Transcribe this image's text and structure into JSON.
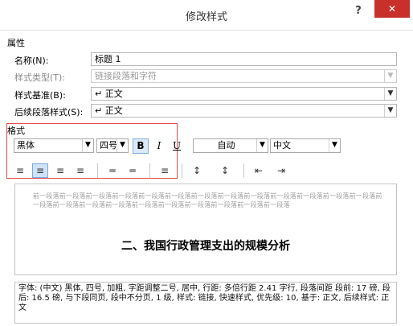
{
  "dialog": {
    "title": "修改样式",
    "help_label": "?",
    "close_label": "✕"
  },
  "properties": {
    "section_label": "属性",
    "name_label": "名称(N):",
    "name_value": "标题 1",
    "type_label": "样式类型(T):",
    "type_value": "链接段落和字符",
    "based_on_label": "样式基准(B):",
    "based_on_value": "↵ 正文",
    "following_label": "后续段落样式(S):",
    "following_value": "↵ 正文"
  },
  "format": {
    "section_label": "格式",
    "font": "黑体",
    "size": "四号",
    "bold": "B",
    "italic": "I",
    "underline": "U",
    "color": "自动",
    "language": "中文"
  },
  "preview": {
    "prev_paragraph": "前一段落前一段落前一段落前一段落前一段落前一段落前一段落前一段落前一段落前一段落前一段落前一段落前一段落前一段落前一段落前一段落前一段落前一段落前一段落前一段落前一段落前一段落前一段落",
    "heading": "二、我国行政管理支出的规模分析"
  },
  "description": "字体: (中文) 黑体, 四号, 加粗, 字距调整二号, 居中, 行距: 多倍行距 2.41 字行, 段落间距 段前: 17 磅, 段后: 16.5 磅, 与下段同页, 段中不分页, 1 级, 样式: 链接, 快速样式, 优先级: 10, 基于: 正文, 后续样式: 正文",
  "icons": {
    "dropdown": "▼",
    "align_left": "≡",
    "align_center": "≡",
    "align_right": "≡",
    "justify": "≡",
    "distribute1": "═",
    "distribute2": "═",
    "distribute3": "≡",
    "line_spacing1": "↕",
    "line_spacing2": "↕",
    "indent_decrease": "⇤",
    "indent_increase": "⇥"
  }
}
